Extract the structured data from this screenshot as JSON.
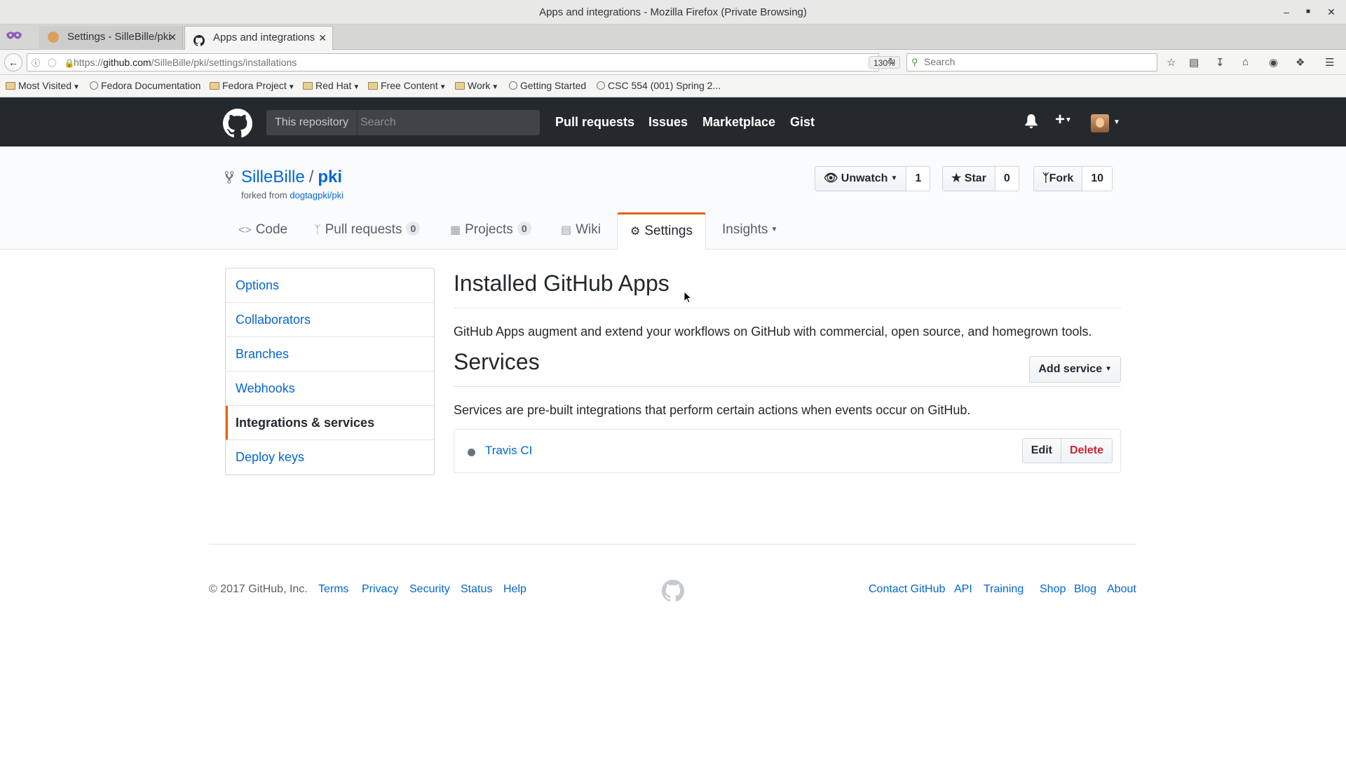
{
  "window": {
    "title": "Apps and integrations - Mozilla Firefox (Private Browsing)"
  },
  "tabs": [
    {
      "label": "Settings - SilleBille/pki"
    },
    {
      "label": "Apps and integrations"
    }
  ],
  "address": {
    "host": "github.com",
    "url_prefix": "https://",
    "url_path": "/SilleBille/pki/settings/installations",
    "zoom": "130%"
  },
  "browser_search": {
    "placeholder": "Search"
  },
  "bookmarks": [
    {
      "label": "Most Visited",
      "icon": "folder-icon"
    },
    {
      "label": "Fedora Documentation",
      "icon": "globe-icon"
    },
    {
      "label": "Fedora Project",
      "icon": "folder-icon"
    },
    {
      "label": "Red Hat",
      "icon": "folder-icon"
    },
    {
      "label": "Free Content",
      "icon": "folder-icon"
    },
    {
      "label": "Work",
      "icon": "folder-icon"
    },
    {
      "label": "Getting Started",
      "icon": "globe-icon"
    },
    {
      "label": "CSC 554 (001) Spring 2...",
      "icon": "globe-icon"
    }
  ],
  "gh_header": {
    "scope": "This repository",
    "search_placeholder": "Search",
    "nav": [
      "Pull requests",
      "Issues",
      "Marketplace",
      "Gist"
    ]
  },
  "repo": {
    "owner": "SilleBille",
    "separator": "/",
    "name": "pki",
    "forked_prefix": "forked from",
    "forked_from": "dogtagpki/pki",
    "unwatch": {
      "label": "Unwatch",
      "count": "1"
    },
    "star": {
      "label": "Star",
      "count": "0"
    },
    "fork": {
      "label": "Fork",
      "count": "10"
    }
  },
  "reponav": [
    {
      "label": "Code",
      "icon": "code-icon"
    },
    {
      "label": "Pull requests",
      "icon": "pull-request-icon",
      "count": "0"
    },
    {
      "label": "Projects",
      "icon": "project-icon",
      "count": "0"
    },
    {
      "label": "Wiki",
      "icon": "book-icon"
    },
    {
      "label": "Settings",
      "icon": "gear-icon"
    },
    {
      "label": "Insights",
      "icon": ""
    }
  ],
  "settings_menu": [
    "Options",
    "Collaborators",
    "Branches",
    "Webhooks",
    "Integrations & services",
    "Deploy keys"
  ],
  "main": {
    "apps_title": "Installed GitHub Apps",
    "apps_desc": "GitHub Apps augment and extend your workflows on GitHub with commercial, open source, and homegrown tools.",
    "services_title": "Services",
    "add_service": "Add service",
    "services_desc": "Services are pre-built integrations that perform certain actions when events occur on GitHub.",
    "service": {
      "name": "Travis CI",
      "edit": "Edit",
      "delete": "Delete"
    }
  },
  "footer": {
    "copyright": "© 2017 GitHub, Inc.",
    "left_links": [
      "Terms",
      "Privacy",
      "Security",
      "Status",
      "Help"
    ],
    "right_links": [
      "Contact GitHub",
      "API",
      "Training",
      "Shop",
      "Blog",
      "About"
    ]
  },
  "colors": {
    "accent_orange": "#e36209",
    "link_blue": "#0366d6",
    "header_dark": "#24292e",
    "danger_red": "#cb2431"
  }
}
